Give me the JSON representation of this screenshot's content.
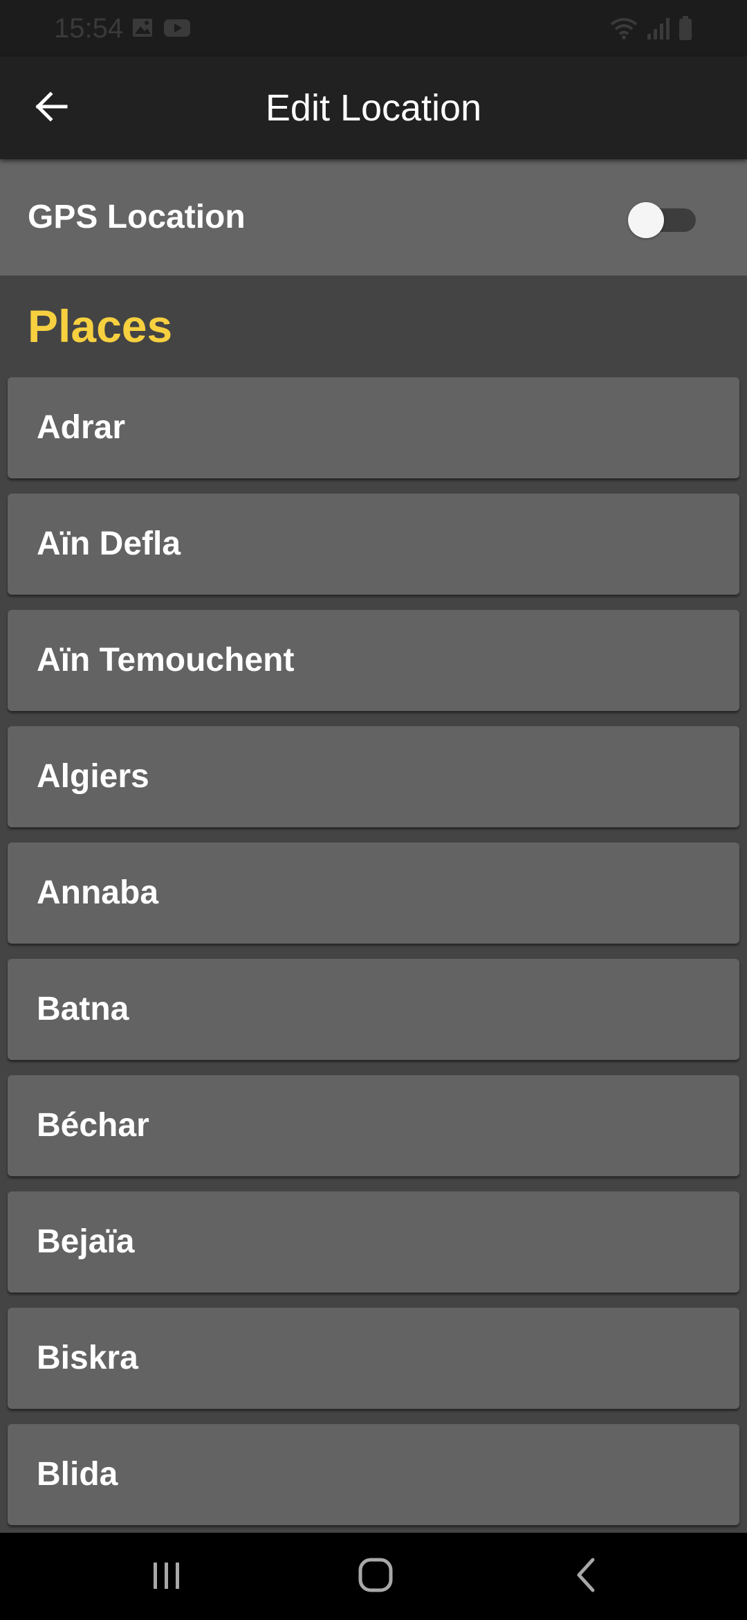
{
  "status_bar": {
    "time": "15:54",
    "left_icons": [
      "image-icon",
      "youtube-icon"
    ],
    "right_icons": [
      "wifi-icon",
      "signal-icon",
      "battery-icon"
    ]
  },
  "app_bar": {
    "back_icon": "arrow-left-icon",
    "title": "Edit Location"
  },
  "gps": {
    "label": "GPS Location",
    "enabled": false
  },
  "places": {
    "title": "Places",
    "items": [
      {
        "label": "Adrar"
      },
      {
        "label": "Aïn Defla"
      },
      {
        "label": "Aïn Temouchent"
      },
      {
        "label": "Algiers"
      },
      {
        "label": "Annaba"
      },
      {
        "label": "Batna"
      },
      {
        "label": "Béchar"
      },
      {
        "label": "Bejaïa"
      },
      {
        "label": "Biskra"
      },
      {
        "label": "Blida"
      }
    ]
  },
  "nav_bar": {
    "icons": [
      "recent-apps-icon",
      "home-icon",
      "back-chevron-icon"
    ]
  },
  "colors": {
    "accent": "#f7d040",
    "app_bar": "#212121",
    "list_item": "#636363",
    "background": "#444444"
  }
}
